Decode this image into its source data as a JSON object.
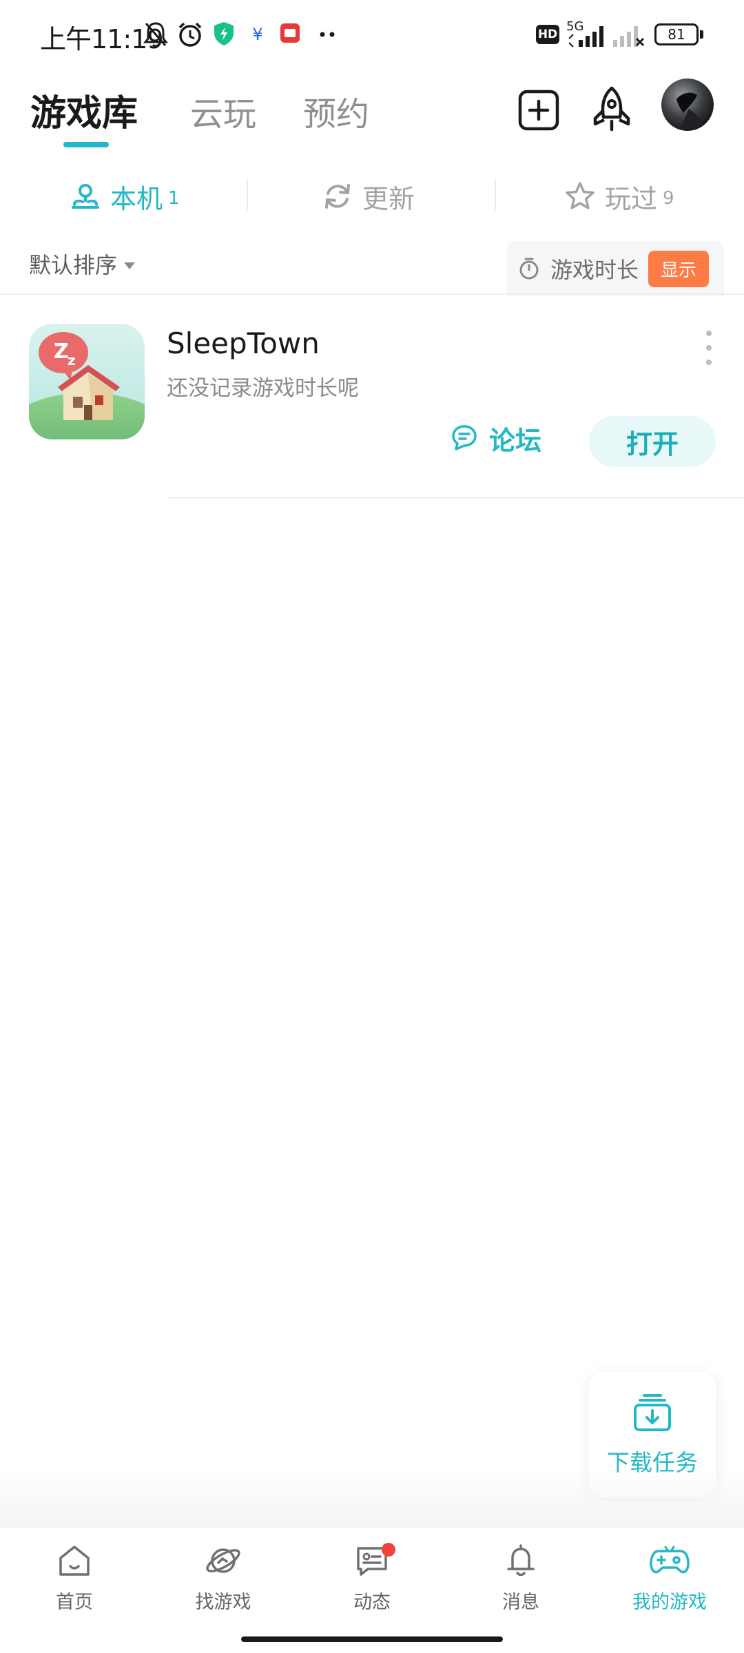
{
  "status_bar": {
    "time": "上午11:19",
    "battery": "81",
    "network_label": "5G",
    "hd_label": "HD"
  },
  "header": {
    "tabs": [
      {
        "label": "游戏库",
        "active": true
      },
      {
        "label": "云玩",
        "active": false
      },
      {
        "label": "预约",
        "active": false
      }
    ],
    "icons": [
      "add-square-icon",
      "rocket-icon",
      "avatar"
    ]
  },
  "subtabs": [
    {
      "label": "本机",
      "count": "1",
      "icon": "location-pin-icon",
      "active": true
    },
    {
      "label": "更新",
      "count": "",
      "icon": "refresh-icon",
      "active": false
    },
    {
      "label": "玩过",
      "count": "9",
      "icon": "star-icon",
      "active": false
    }
  ],
  "sort": {
    "label": "默认排序",
    "playtime_label": "游戏时长",
    "show_label": "显示"
  },
  "games": [
    {
      "title": "SleepTown",
      "subtitle": "还没记录游戏时长呢",
      "forum_label": "论坛",
      "open_label": "打开"
    }
  ],
  "download": {
    "label": "下载任务"
  },
  "bottom_nav": [
    {
      "label": "首页",
      "icon": "home-icon",
      "active": false
    },
    {
      "label": "找游戏",
      "icon": "planet-icon",
      "active": false
    },
    {
      "label": "动态",
      "icon": "chat-card-icon",
      "active": false,
      "badge": true
    },
    {
      "label": "消息",
      "icon": "bell-icon",
      "active": false
    },
    {
      "label": "我的游戏",
      "icon": "gamepad-icon",
      "active": true
    }
  ],
  "colors": {
    "accent": "#22b8c6",
    "badge_orange": "#ff7b45",
    "notification_red": "#f0433a"
  }
}
